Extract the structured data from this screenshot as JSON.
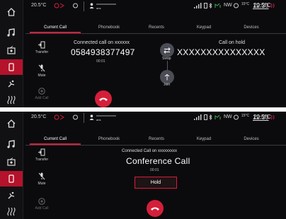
{
  "status_bar": {
    "temp_left": "20.5°C",
    "phone_name": "xxxxxxxxxxxxxx",
    "phone_sub": "ans",
    "compass": "NW",
    "outside_temp": "15°C",
    "time": "12:30",
    "temp_right": "20.5°C"
  },
  "tabs": [
    "Current Call",
    "Phonebook",
    "Recents",
    "Keypad",
    "Devices"
  ],
  "controls": {
    "transfer_label": "Transfer",
    "mute_label": "Mute",
    "add_call_label": "Add Call"
  },
  "screen1": {
    "connected_label": "Connected call on xxxxxx",
    "connected_number": "0584938377497",
    "connected_duration": "00:01",
    "swap_label": "Swap",
    "join_label": "Join",
    "hold_label": "Call on hold",
    "hold_number": "XXXXXXXXXXXXXXX"
  },
  "screen2": {
    "connected_label": "Connected Call on xxxxxxxxx",
    "title": "Conference Call",
    "duration": "00:01",
    "hold_button": "Hold"
  },
  "colors": {
    "accent": "#d41f3a",
    "background": "#0b0b0e"
  },
  "icons": [
    "home-icon",
    "music-icon",
    "radio-icon",
    "phone-icon",
    "climate-icon",
    "seat-heat-icon"
  ]
}
